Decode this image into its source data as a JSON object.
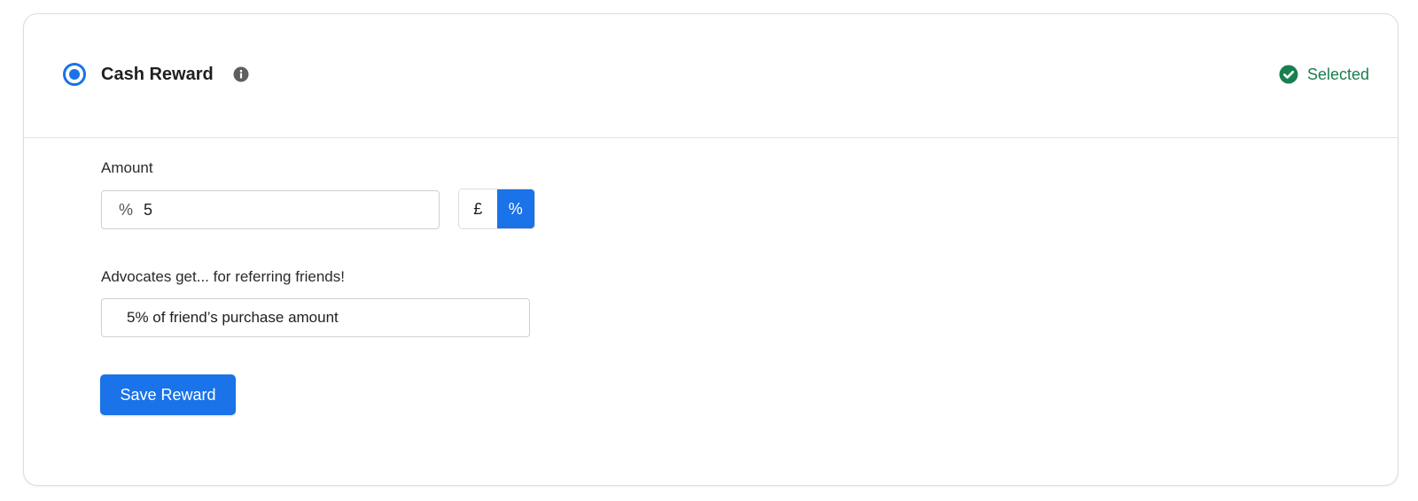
{
  "header": {
    "title": "Cash Reward",
    "status": "Selected",
    "radio_selected": true,
    "info_icon": "info-icon",
    "status_icon": "check-circle-icon"
  },
  "amount": {
    "label": "Amount",
    "prefix": "%",
    "value": "5",
    "units": [
      {
        "label": "£",
        "active": false
      },
      {
        "label": "%",
        "active": true
      }
    ]
  },
  "description": {
    "label": "Advocates get... for referring friends!",
    "value": "5% of friend’s purchase amount"
  },
  "actions": {
    "save_label": "Save Reward"
  },
  "colors": {
    "accent": "#1a73e8",
    "success": "#1a7f4e",
    "border": "#dcdcdc"
  }
}
